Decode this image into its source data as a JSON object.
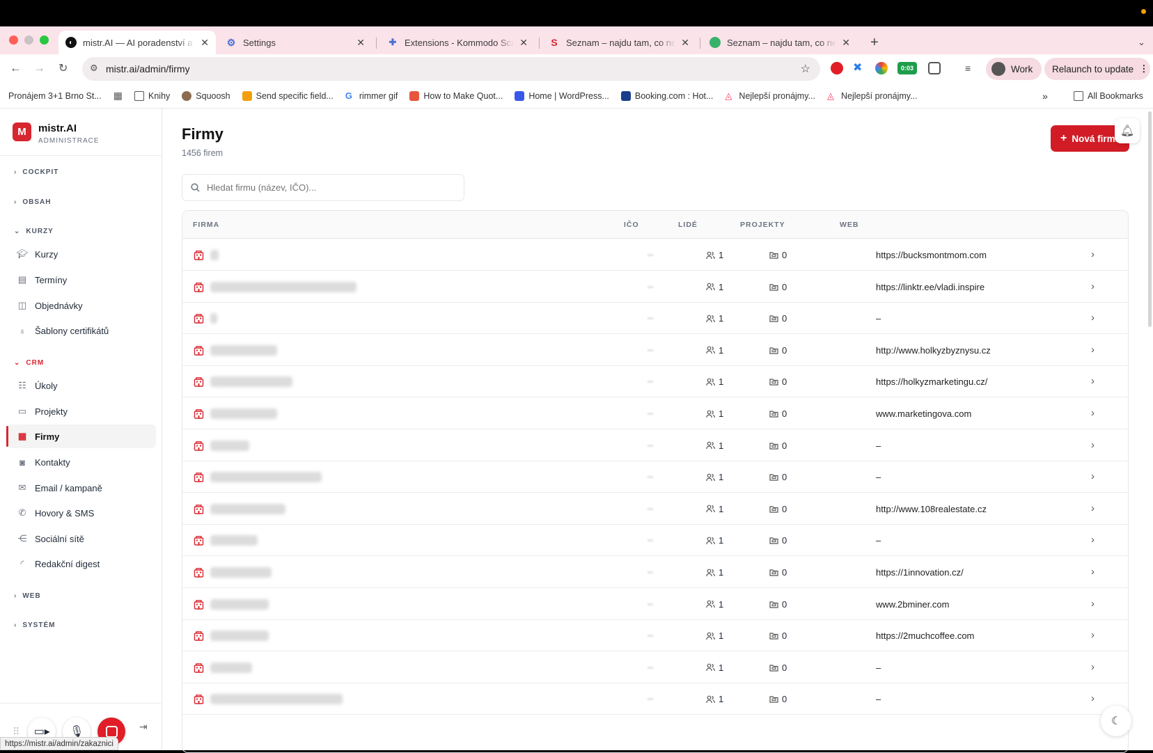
{
  "browser": {
    "tabs": [
      {
        "title": "mistr.AI — AI poradenství a šk",
        "active": true,
        "icon": "mistr-logo-icon"
      },
      {
        "title": "Settings",
        "active": false,
        "icon": "gear-icon"
      },
      {
        "title": "Extensions - Kommodo Scree",
        "active": false,
        "icon": "puzzle-icon"
      },
      {
        "title": "Seznam – najdu tam, co nezn",
        "active": false,
        "icon": "seznam-icon"
      },
      {
        "title": "Seznam – najdu tam, co nezn",
        "active": false,
        "icon": "seznam-globe-icon"
      }
    ],
    "url": "mistr.ai/admin/firmy",
    "profile_label": "Work",
    "relaunch_label": "Relaunch to update",
    "timer_badge": "0:03",
    "bookmarks": [
      {
        "label": "Pronájem 3+1 Brno St...",
        "icon": "none"
      },
      {
        "label": "Knihy",
        "icon": "folder-icon"
      },
      {
        "label": "Squoosh",
        "icon": "squoosh-icon"
      },
      {
        "label": "Send specific field...",
        "icon": "zapier-icon"
      },
      {
        "label": "rimmer gif",
        "icon": "google-icon"
      },
      {
        "label": "How to Make Quot...",
        "icon": "hubspot-icon"
      },
      {
        "label": "Home | WordPress...",
        "icon": "wordpress-icon"
      },
      {
        "label": "Booking.com : Hot...",
        "icon": "booking-icon"
      },
      {
        "label": "Nejlepší pronájmy...",
        "icon": "airbnb-icon"
      },
      {
        "label": "Nejlepší pronájmy...",
        "icon": "airbnb-icon"
      }
    ],
    "all_bookmarks_label": "All Bookmarks",
    "status_url": "https://mistr.ai/admin/zakaznici"
  },
  "sidebar": {
    "logo_letter": "M",
    "brand": "mistr.AI",
    "brand_sub": "ADMINISTRACE",
    "sections": [
      {
        "label": "COCKPIT",
        "expanded": false
      },
      {
        "label": "OBSAH",
        "expanded": false
      },
      {
        "label": "KURZY",
        "expanded": true
      },
      {
        "label": "CRM",
        "expanded": true
      },
      {
        "label": "WEB",
        "expanded": false
      },
      {
        "label": "SYSTÉM",
        "expanded": false
      }
    ],
    "kurzy_items": [
      "Kurzy",
      "Termíny",
      "Objednávky",
      "Šablony certifikátů"
    ],
    "crm_items": [
      "Úkoly",
      "Projekty",
      "Firmy",
      "Kontakty",
      "Email / kampaně",
      "Hovory & SMS",
      "Sociální sítě",
      "Redakční digest"
    ],
    "active_item": "Firmy"
  },
  "main": {
    "title": "Firmy",
    "count": "1456 firem",
    "new_button": "Nová firma",
    "search_placeholder": "Hledat firmu (název, IČO)...",
    "columns": [
      "FIRMA",
      "IČO",
      "LIDÉ",
      "PROJEKTY",
      "WEB"
    ],
    "rows": [
      {
        "people": "1",
        "projects": "0",
        "web": "https://bucksmontmom.com"
      },
      {
        "people": "1",
        "projects": "0",
        "web": "https://linktr.ee/vladi.inspire"
      },
      {
        "people": "1",
        "projects": "0",
        "web": "–"
      },
      {
        "people": "1",
        "projects": "0",
        "web": "http://www.holkyzbyznysu.cz"
      },
      {
        "people": "1",
        "projects": "0",
        "web": "https://holkyzmarketingu.cz/"
      },
      {
        "people": "1",
        "projects": "0",
        "web": "www.marketingova.com"
      },
      {
        "people": "1",
        "projects": "0",
        "web": "–"
      },
      {
        "people": "1",
        "projects": "0",
        "web": "–"
      },
      {
        "people": "1",
        "projects": "0",
        "web": "http://www.108realestate.cz"
      },
      {
        "people": "1",
        "projects": "0",
        "web": "–"
      },
      {
        "people": "1",
        "projects": "0",
        "web": "https://1innovation.cz/"
      },
      {
        "people": "1",
        "projects": "0",
        "web": "www.2bminer.com"
      },
      {
        "people": "1",
        "projects": "0",
        "web": "https://2muchcoffee.com"
      },
      {
        "people": "1",
        "projects": "0",
        "web": "–"
      },
      {
        "people": "1",
        "projects": "0",
        "web": "–"
      }
    ]
  }
}
